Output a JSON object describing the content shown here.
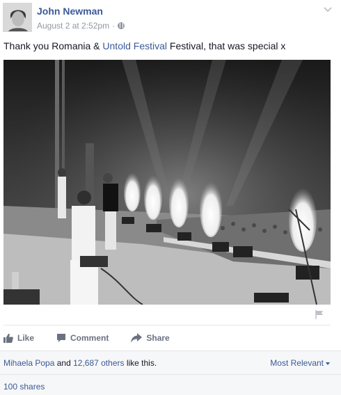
{
  "post": {
    "author": "John Newman",
    "timestamp": "August 2 at 2:52pm",
    "separator": "·",
    "privacy_icon": "globe-icon",
    "options_icon": "chevron-down-icon",
    "status_parts": {
      "before": "Thank you Romania & ",
      "tag": "Untold Festival",
      "after": " Festival, that was special x"
    },
    "photo_description_icon": "concert-photo"
  },
  "actions": {
    "like": "Like",
    "comment": "Comment",
    "share": "Share"
  },
  "reactions": {
    "first_liker": "Mihaela Popa",
    "connector": " and ",
    "others_count": "12,687 others",
    "suffix": " like this.",
    "sort_label": "Most Relevant"
  },
  "shares": {
    "label": "100 shares"
  },
  "colors": {
    "link": "#3b5998",
    "muted": "#9197a3",
    "action": "#6a7180"
  }
}
